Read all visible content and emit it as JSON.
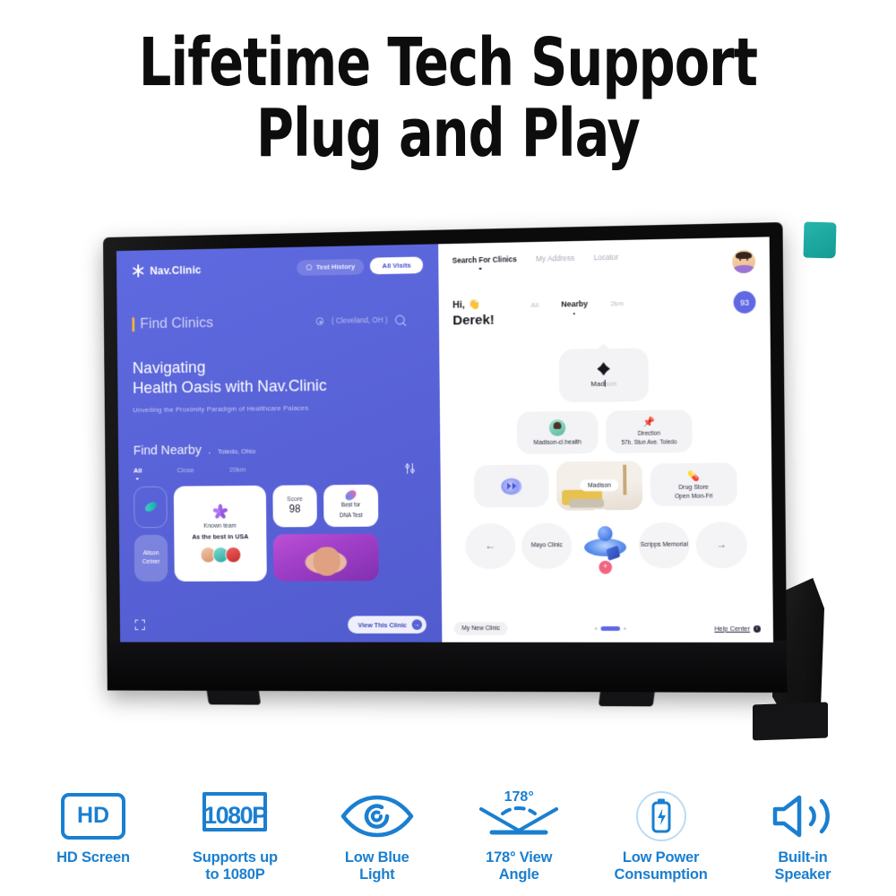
{
  "headline": {
    "line1": "Lifetime Tech Support",
    "line2": "Plug and Play"
  },
  "colors": {
    "feature_blue": "#1a7fd0",
    "ui_purple": "#5b66dc",
    "accent_indigo": "#6069e4",
    "teal_tab": "#17a89f",
    "score_badge": "#6069e4",
    "plus_fab": "#f4637f"
  },
  "screen": {
    "left_panel": {
      "brand": {
        "name": "Nav.Clinic",
        "icon": "asterisk-logo-icon"
      },
      "actions": [
        {
          "label": "Test History",
          "icon": "clock-icon",
          "style": "ghost"
        },
        {
          "label": "All Visits",
          "style": "solid"
        }
      ],
      "find": {
        "title": "Find Clinics",
        "location": "( Cleveland, OH )",
        "location_icon": "map-pin-icon",
        "search_icon": "search-icon"
      },
      "hero": {
        "line1": "Navigating",
        "line2": "Health Oasis with Nav.Clinic",
        "subtitle": "Unveiling the Proximity Paradigm of Healthcare Palaces"
      },
      "nearby": {
        "title": "Find Nearby",
        "separator": ".",
        "city": "Toledo, Ohio",
        "filters": [
          {
            "label": "All",
            "active": true
          },
          {
            "label": "Close",
            "active": false
          },
          {
            "label": "20km",
            "active": false
          }
        ],
        "sliders_icon": "filter-sliders-icon"
      },
      "cards": {
        "capsule_icon": "pill-capsule-icon",
        "person": "Alison Cetner",
        "team": {
          "flower_icon": "flower-logo-icon",
          "line1": "Known team",
          "line2": "As the best in USA"
        },
        "score": {
          "label": "Score",
          "value": "98"
        },
        "dna": {
          "icon": "dna-helix-icon",
          "line1": "Best for",
          "line2": "DNA Test"
        }
      },
      "footer": {
        "expand_icon": "expand-corners-icon",
        "cta": "View This Clinic",
        "cta_arrow": "→"
      }
    },
    "right_panel": {
      "nav": [
        {
          "label": "Search For Clinics",
          "active": true
        },
        {
          "label": "My Address",
          "active": false
        },
        {
          "label": "Locator",
          "active": false
        }
      ],
      "avatar": "user-avatar",
      "greeting": {
        "hi": "Hi,",
        "wave": "👋",
        "name": "Derek!"
      },
      "tabs": [
        {
          "label": "All",
          "active": false
        },
        {
          "label": "Nearby",
          "active": true
        },
        {
          "label": "2km",
          "active": false
        }
      ],
      "badge": "93",
      "search_card": {
        "logo_icon": "nav-clinic-diamond-icon",
        "typed": "Mad",
        "placeholder_rest": "son"
      },
      "tiles": [
        {
          "name": "doctor-tile",
          "icon": "doctor-avatar-icon",
          "label": "Madison-cl.health"
        },
        {
          "name": "direction-tile",
          "icon": "pushpin-icon",
          "line1": "Direction",
          "line2": "57b. Stun Ave. Toledo"
        },
        {
          "name": "play-tile",
          "icon": "play-button-icon",
          "label": ""
        },
        {
          "name": "room-tile",
          "icon": "clinic-room-photo",
          "label": "Madison"
        },
        {
          "name": "drugstore-tile",
          "icon": "pills-icon",
          "line1": "Drug Store",
          "line2": "Open Mon-Fri"
        }
      ],
      "carousel": {
        "prev_icon": "←",
        "next_icon": "→",
        "items": [
          {
            "label": "Mayo Clinic"
          },
          {
            "label": "",
            "icon": "blue-orb-3d-icon",
            "fab": "+"
          },
          {
            "label": "Scripps Memorial"
          }
        ]
      },
      "footer": {
        "new_clinic": "My New Clinic",
        "help": "Help Center",
        "help_icon": "info-icon"
      }
    }
  },
  "features": [
    {
      "icon": "hd-screen-icon",
      "icon_text": "HD",
      "caption": "HD Screen"
    },
    {
      "icon": "resolution-1080p-icon",
      "icon_text": "1080P",
      "caption": "Supports up\nto 1080P",
      "cap_line1": "Supports up",
      "cap_line2": "to 1080P"
    },
    {
      "icon": "eye-low-blue-light-icon",
      "caption": "Low Blue Light",
      "cap_line1": "Low Blue",
      "cap_line2": "Light"
    },
    {
      "icon": "view-angle-icon",
      "icon_text": "178°",
      "caption": "178° View Angle",
      "cap_line1": "178° View",
      "cap_line2": "Angle"
    },
    {
      "icon": "battery-low-power-icon",
      "caption": "Low Power Consumption",
      "cap_line1": "Low Power",
      "cap_line2": "Consumption"
    },
    {
      "icon": "speaker-icon",
      "caption": "Built-in Speaker",
      "cap_line1": "Built-in",
      "cap_line2": "Speaker"
    }
  ]
}
